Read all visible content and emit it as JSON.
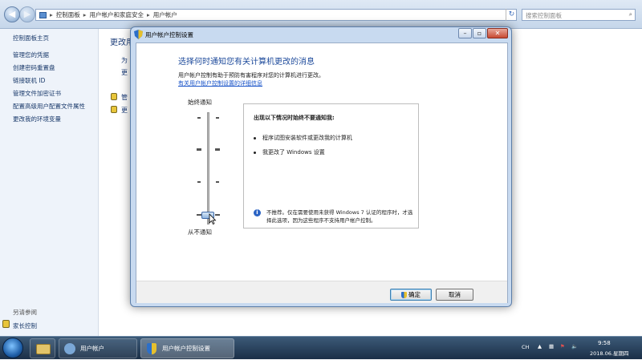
{
  "explorer": {
    "breadcrumb": [
      "控制面板",
      "用户帐户和家庭安全",
      "用户帐户"
    ],
    "search_placeholder": "搜索控制面板",
    "sidebar_links": [
      "控制面板主页",
      "管理您的凭据",
      "创建密码重置盘",
      "链接联机 ID",
      "管理文件加密证书",
      "配置高级用户配置文件属性",
      "更改我的环境变量"
    ],
    "see_also_title": "另请参阅",
    "see_also_item": "家长控制",
    "main_heading": "更改用户",
    "main_partial": [
      "为",
      "更",
      "管",
      "更"
    ]
  },
  "dialog": {
    "title": "用户帐户控制设置",
    "heading": "选择何时通知您有关计算机更改的消息",
    "description": "用户帐户控制有助于预防有害程序对您的计算机进行更改。",
    "link": "有关用户帐户控制设置的详细信息",
    "slider_top_label": "始终通知",
    "slider_bottom_label": "从不通知",
    "slider_level": "4 of 4 (bottom position: Never notify)",
    "info_heading": "出现以下情况时始终不要通知我:",
    "info_items": [
      "程序试图安装软件或更改我的计算机",
      "我更改了 Windows 设置"
    ],
    "note": "不推荐。仅在需要使用未获得 Windows 7 认证的程序时，才选择此选项，因为这些程序不支持用户帐户控制。",
    "ok_label": "确定",
    "cancel_label": "取消"
  },
  "taskbar": {
    "items": [
      "用户帐户",
      "用户帐户控制设置"
    ],
    "lang": "CH",
    "time": "9:58",
    "date": "2018.06.星期四"
  }
}
